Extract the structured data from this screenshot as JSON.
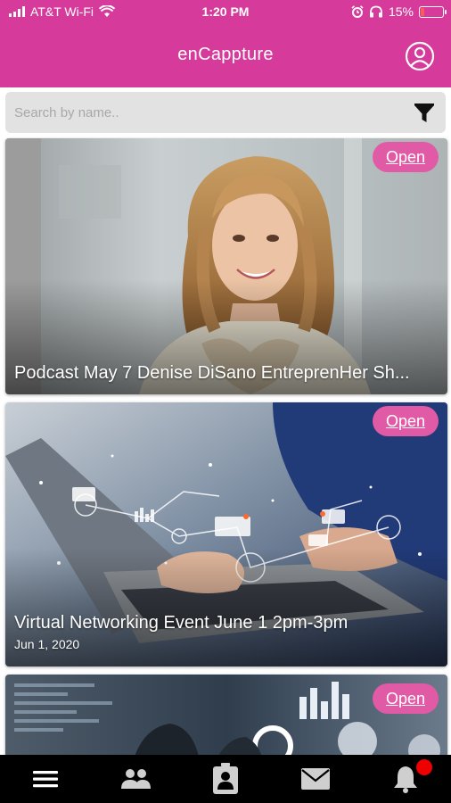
{
  "status_bar": {
    "carrier": "AT&T Wi-Fi",
    "time": "1:20 PM",
    "battery_percent": "15%",
    "battery_level": 0.15,
    "icons": [
      "signal-icon",
      "wifi-icon",
      "alarm-icon",
      "headphones-icon",
      "battery-icon"
    ]
  },
  "header": {
    "title": "enCappture",
    "profile_icon": "profile-icon"
  },
  "search": {
    "placeholder": "Search by name..",
    "value": "",
    "filter_icon": "filter-icon"
  },
  "cards": [
    {
      "title": "Podcast May 7  Denise DiSano  EntreprenHer Sh...",
      "date": "",
      "badge": "Open"
    },
    {
      "title": "Virtual Networking Event June 1  2pm-3pm",
      "date": "Jun 1, 2020",
      "badge": "Open"
    },
    {
      "title": "",
      "date": "",
      "badge": "Open"
    }
  ],
  "bottom_nav": {
    "items": [
      "menu-icon",
      "people-icon",
      "badge-icon",
      "mail-icon",
      "bell-icon"
    ],
    "notification_color": "#ee0000"
  },
  "colors": {
    "brand": "#d63a9a",
    "badge": "#e05aa6",
    "nav_background": "#000000"
  }
}
